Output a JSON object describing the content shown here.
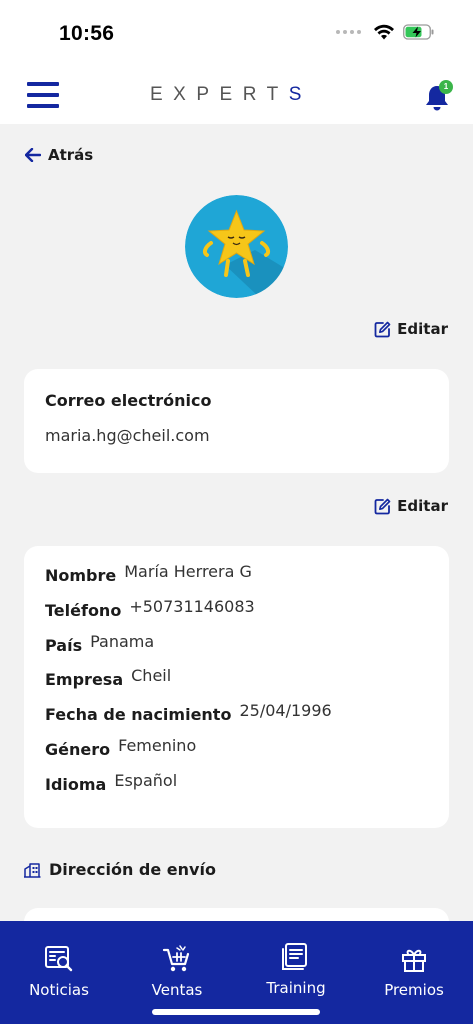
{
  "status": {
    "time": "10:56"
  },
  "header": {
    "brand_main": "EXPERT",
    "brand_accent": "S",
    "notification_count": "1"
  },
  "nav": {
    "back_label": "Atrás"
  },
  "email_section": {
    "edit_label": "Editar",
    "title": "Correo electrónico",
    "value": "maria.hg@cheil.com"
  },
  "personal_section": {
    "edit_label": "Editar",
    "fields": [
      {
        "label": "Nombre",
        "value": "María Herrera G"
      },
      {
        "label": "Teléfono",
        "value": "+50731146083"
      },
      {
        "label": "País",
        "value": "Panama"
      },
      {
        "label": "Empresa",
        "value": "Cheil"
      },
      {
        "label": "Fecha de nacimiento",
        "value": "25/04/1996"
      },
      {
        "label": "Género",
        "value": "Femenino"
      },
      {
        "label": "Idioma",
        "value": "Español"
      }
    ]
  },
  "address_section": {
    "title": "Dirección de envío"
  },
  "bottom_nav": {
    "items": [
      {
        "label": "Noticias",
        "icon": "news-icon"
      },
      {
        "label": "Ventas",
        "icon": "cart-icon"
      },
      {
        "label": "Training",
        "icon": "training-icon"
      },
      {
        "label": "Premios",
        "icon": "gift-icon"
      }
    ]
  },
  "colors": {
    "brand_blue": "#1428a0",
    "background": "#f2f2f2",
    "avatar_bg": "#1fa6d6",
    "star": "#f6c619",
    "badge": "#3bb54a"
  }
}
